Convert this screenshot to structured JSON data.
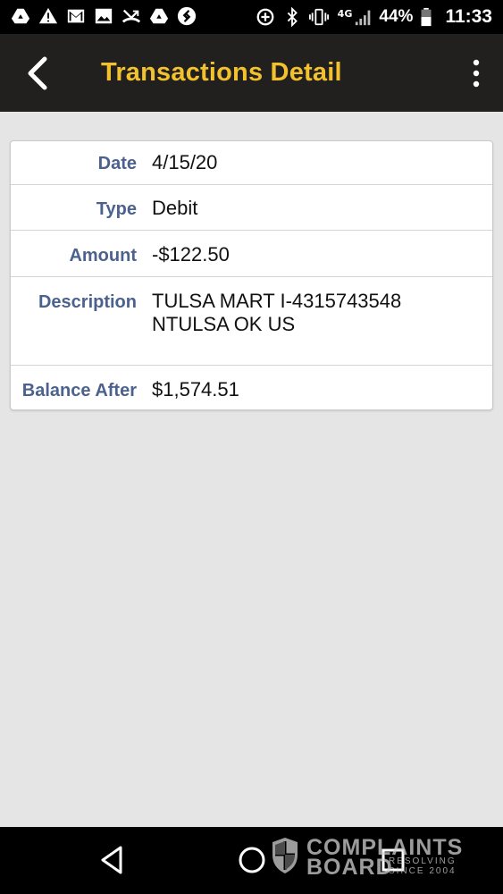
{
  "status_bar": {
    "left_icons": [
      "drive-icon",
      "warning-icon",
      "gmail-icon",
      "image-icon",
      "missed-call-icon",
      "drive-icon",
      "shazam-icon"
    ],
    "right_icons": [
      "data-saver-icon",
      "bluetooth-icon",
      "vibrate-icon",
      "lte-signal-icon",
      "battery-icon"
    ],
    "network": "4G",
    "battery_percent": "44%",
    "time": "11:33"
  },
  "app_bar": {
    "title": "Transactions Detail",
    "title_color": "#f2c12e",
    "background": "#221f1f"
  },
  "transaction": {
    "rows": [
      {
        "label": "Date",
        "value": "4/15/20"
      },
      {
        "label": "Type",
        "value": "Debit"
      },
      {
        "label": "Amount",
        "value": "-$122.50"
      },
      {
        "label": "Description",
        "value": "TULSA MART I-4315743548\nNTULSA OK US"
      },
      {
        "label": "Balance After",
        "value": "$1,574.51"
      }
    ]
  },
  "label_color": "#4c628e",
  "nav_bar": {
    "buttons": [
      "back-icon",
      "home-icon",
      "recents-icon"
    ]
  },
  "watermark": {
    "line1": "COMPLAINTS",
    "line2": "BOARD",
    "small1": "RESOLVING",
    "small2": "SINCE 2004"
  }
}
